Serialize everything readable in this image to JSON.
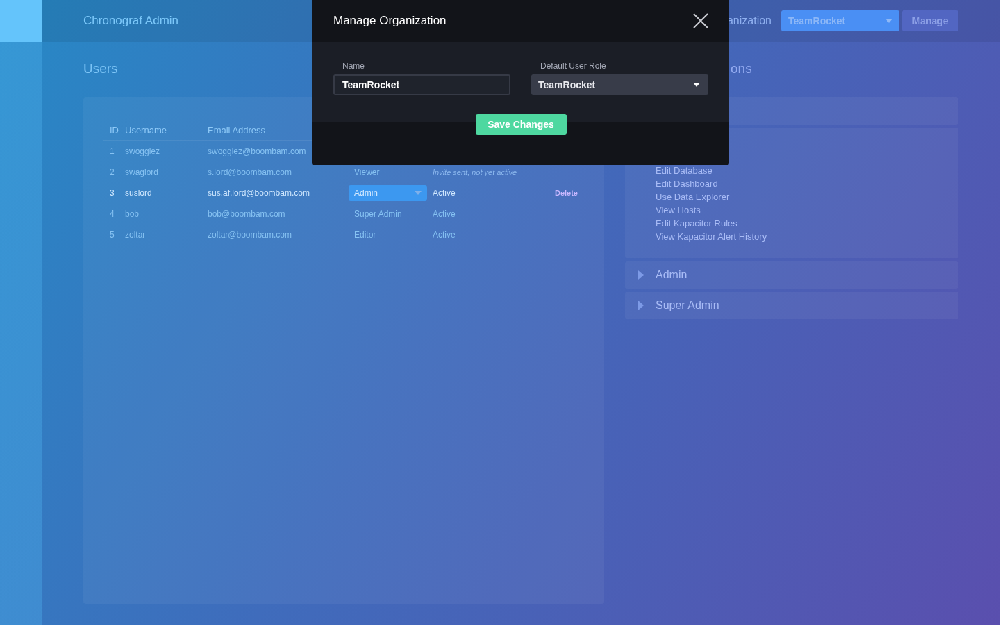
{
  "header": {
    "title": "Chronograf Admin",
    "org_label": "anization",
    "org_select": "TeamRocket",
    "manage_button": "Manage"
  },
  "users": {
    "title": "Users",
    "columns": [
      "ID",
      "Username",
      "Email Address"
    ],
    "rows": [
      {
        "id": "1",
        "username": "swogglez",
        "email": "swogglez@boombam.com",
        "selected": false
      },
      {
        "id": "2",
        "username": "swaglord",
        "email": "s.lord@boombam.com",
        "role": "Viewer",
        "status": "Invite sent, not yet active",
        "pending": true,
        "selected": false
      },
      {
        "id": "3",
        "username": "suslord",
        "email": "sus.af.lord@boombam.com",
        "role": "Admin",
        "status": "Active",
        "pending": false,
        "delete": "Delete",
        "selected": true
      },
      {
        "id": "4",
        "username": "bob",
        "email": "bob@boombam.com",
        "role": "Super Admin",
        "status": "Active",
        "pending": false,
        "selected": false
      },
      {
        "id": "5",
        "username": "zoltar",
        "email": "zoltar@boombam.com",
        "role": "Editor",
        "status": "Active",
        "pending": false,
        "selected": false
      }
    ]
  },
  "permissions": {
    "title": "ons",
    "sections": [
      {
        "expanded": true,
        "items": [
          "Edit Database",
          "Edit Dashboard",
          "Use Data Explorer",
          "View Hosts",
          "Edit Kapacitor Rules",
          "View Kapacitor Alert History"
        ]
      },
      {
        "title": "Admin",
        "expanded": false
      },
      {
        "title": "Super Admin",
        "expanded": false
      }
    ]
  },
  "modal": {
    "title": "Manage Organization",
    "name_label": "Name",
    "name_value": "TeamRocket",
    "role_label": "Default User Role",
    "role_value": "TeamRocket",
    "save_button": "Save Changes"
  }
}
